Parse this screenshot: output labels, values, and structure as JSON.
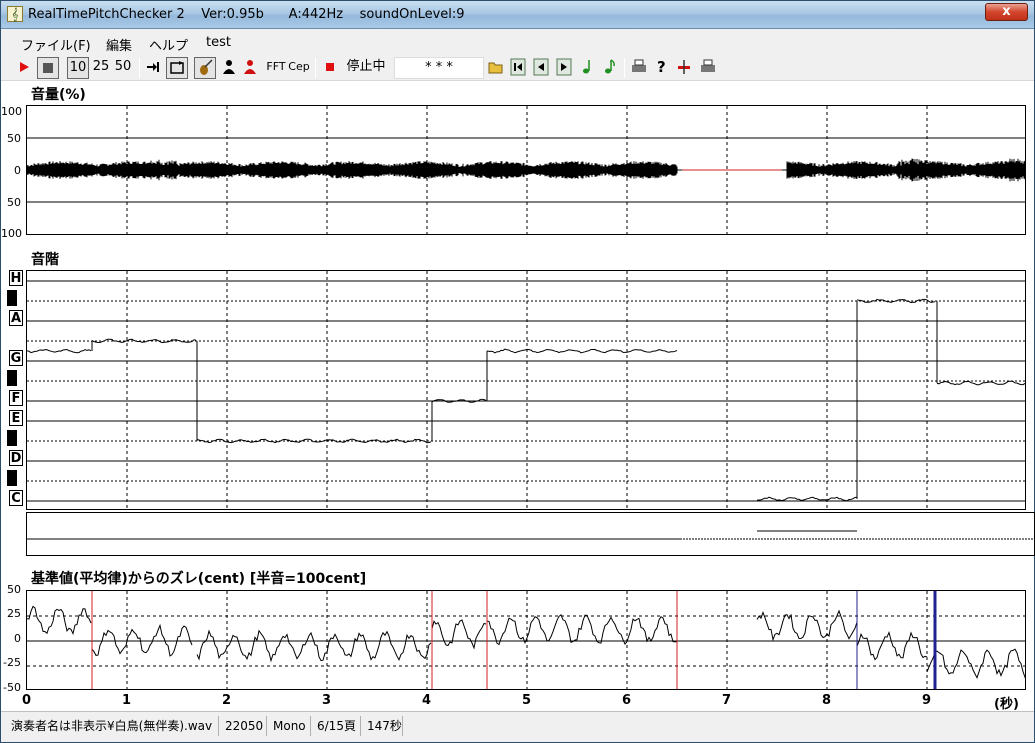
{
  "window": {
    "title": "RealTimePitchChecker 2    Ver:0.95b      A:442Hz    soundOnLevel:9",
    "close_label": "x"
  },
  "menu": [
    "ファイル(F)",
    "編集",
    "ヘルプ",
    "test"
  ],
  "toolbar": {
    "zoom_options": [
      "10",
      "25",
      "50"
    ],
    "fft_label": "FFT",
    "cep_label": "Cep",
    "status_label": "停止中",
    "note_display": "* * *"
  },
  "volume": {
    "title": "音量(%)",
    "y_labels": [
      "100",
      "50",
      "0",
      "50",
      "100"
    ]
  },
  "scale": {
    "title": "音階",
    "notes": [
      "H",
      "A",
      "G",
      "F",
      "E",
      "D",
      "C"
    ]
  },
  "deviation": {
    "title": "基準値(平均律)からのズレ(cent) [半音=100cent]",
    "y_labels": [
      "50",
      "25",
      "0",
      "-25",
      "-50"
    ]
  },
  "time_axis": {
    "labels": [
      "0",
      "1",
      "2",
      "3",
      "4",
      "5",
      "6",
      "7",
      "8",
      "9"
    ],
    "unit": "(秒)"
  },
  "status": {
    "file": "演奏者名は非表示¥白鳥(無伴奏).wav",
    "rate": "22050",
    "channels": "Mono",
    "page": "6/15頁",
    "duration": "147秒"
  },
  "pitch_segments": [
    {
      "t0": 0.0,
      "t1": 0.65,
      "note": 7.5
    },
    {
      "t0": 0.65,
      "t1": 1.7,
      "note": 8.0
    },
    {
      "t0": 1.7,
      "t1": 4.05,
      "note": 3.0
    },
    {
      "t0": 4.05,
      "t1": 4.6,
      "note": 5.0
    },
    {
      "t0": 4.6,
      "t1": 6.5,
      "note": 7.5
    },
    {
      "t0": 7.3,
      "t1": 8.3,
      "note": 0.1
    },
    {
      "t0": 8.3,
      "t1": 9.1,
      "note": 10.0
    },
    {
      "t0": 9.1,
      "t1": 10.0,
      "note": 5.9
    }
  ]
}
